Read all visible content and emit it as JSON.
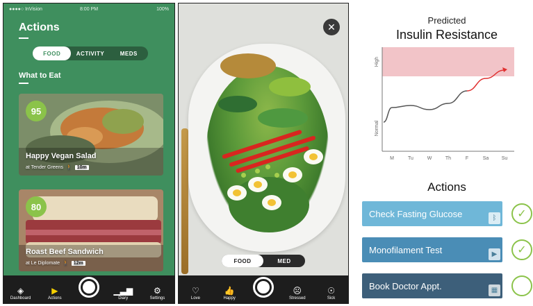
{
  "actions_screen": {
    "status": {
      "carrier": "●●●●○ InVision",
      "time": "8:00 PM",
      "battery": "100%"
    },
    "title": "Actions",
    "tabs": [
      {
        "label": "FOOD"
      },
      {
        "label": "ACTIVITY"
      },
      {
        "label": "MEDS"
      }
    ],
    "section_title": "What to Eat",
    "cards": [
      {
        "score": "95",
        "name": "Happy Vegan Salad",
        "location": "at Tender Greens",
        "distance": "10m"
      },
      {
        "score": "80",
        "name": "Roast Beef Sandwich",
        "location": "at Le Diplomate",
        "distance": "12m"
      }
    ],
    "nav": [
      {
        "label": "Dashboard",
        "icon": "layers-icon"
      },
      {
        "label": "Actions",
        "icon": "play-icon"
      },
      {
        "label": "Diary",
        "icon": "bar-chart-icon"
      },
      {
        "label": "Settings",
        "icon": "gear-icon"
      }
    ]
  },
  "food_screen": {
    "toggle": [
      {
        "label": "FOOD"
      },
      {
        "label": "MED"
      }
    ],
    "nav": [
      {
        "label": "Love",
        "icon": "heart-icon"
      },
      {
        "label": "Happy",
        "icon": "thumbs-up-icon"
      },
      {
        "label": "Stressed",
        "icon": "face-icon"
      },
      {
        "label": "Sick",
        "icon": "sick-face-icon"
      }
    ]
  },
  "insulin_panel": {
    "title_line1": "Predicted",
    "title_line2": "Insulin Resistance",
    "actions_title": "Actions",
    "actions": [
      {
        "label": "Check Fasting Glucose",
        "icon": "bluetooth-icon",
        "checked": true,
        "color": "#6fb7d8"
      },
      {
        "label": "Monofilament Test",
        "icon": "play-icon",
        "checked": true,
        "color": "#4a8db6"
      },
      {
        "label": "Book Doctor Appt.",
        "icon": "calendar-icon",
        "checked": false,
        "color": "#3d5f7a"
      }
    ]
  },
  "chart_data": {
    "type": "line",
    "ylabel": "",
    "y_tick_labels": [
      "Normal",
      "High"
    ],
    "categories": [
      "M",
      "Tu",
      "W",
      "Th",
      "F",
      "Sa",
      "Su"
    ],
    "series": [
      {
        "values": [
          0.42,
          0.44,
          0.4,
          0.46,
          0.58,
          0.7,
          0.78
        ]
      }
    ],
    "ylim": [
      0,
      1
    ],
    "high_band": [
      0.72,
      1.0
    ],
    "colors": {
      "line": "#555555",
      "forecast": "#e03030",
      "band": "#f2c4c8"
    }
  }
}
